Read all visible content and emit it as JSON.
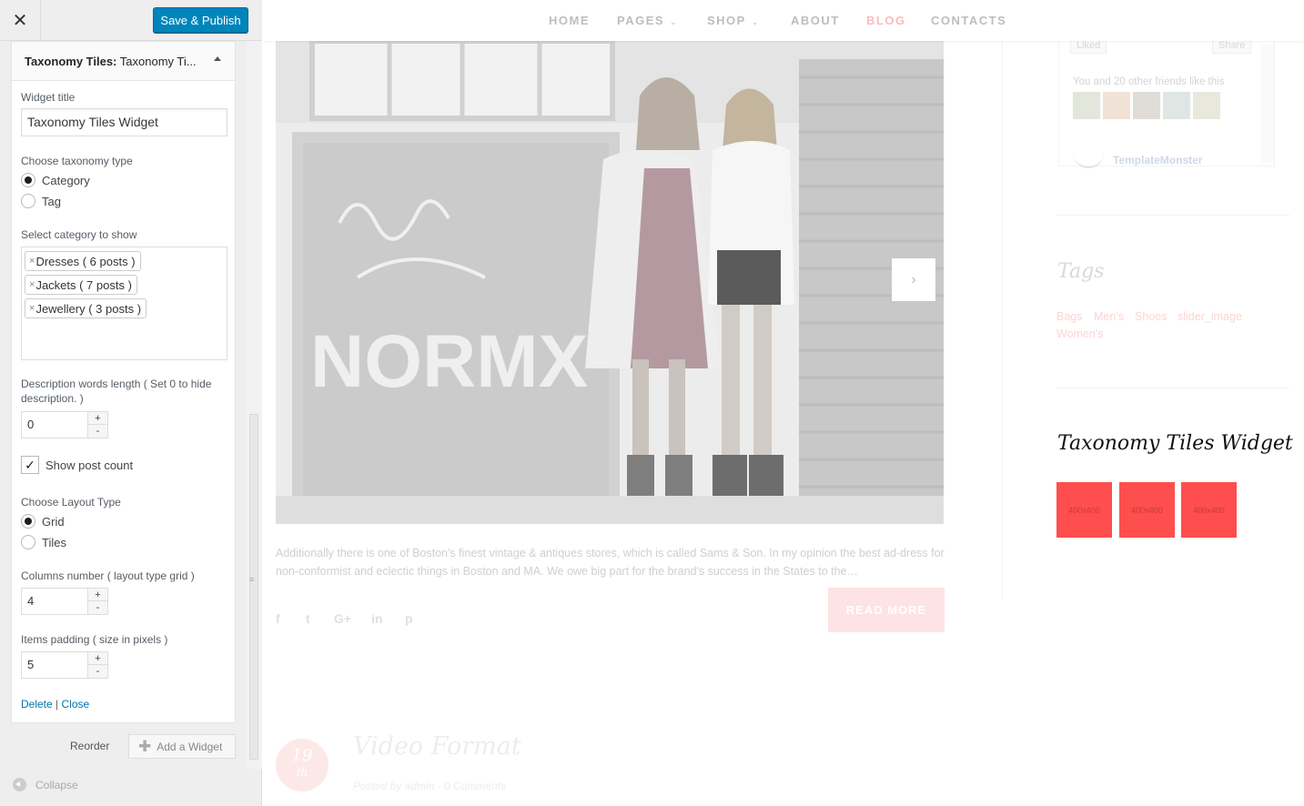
{
  "topbar": {
    "close_glyph": "✕",
    "publish_label": "Save & Publish"
  },
  "widget": {
    "head_bold": "Taxonomy Tiles:",
    "head_sub": "Taxonomy Ti...",
    "title_label": "Widget title",
    "title_value": "Taxonomy Tiles Widget",
    "tax_label": "Choose taxonomy type",
    "tax_options": [
      {
        "label": "Category",
        "checked": true
      },
      {
        "label": "Tag",
        "checked": false
      }
    ],
    "cat_label": "Select category to show",
    "categories": [
      "Dresses ( 6 posts )",
      "Jackets ( 7 posts )",
      "Jewellery ( 3 posts )"
    ],
    "remove_glyph": "×",
    "desc_label_1": "Description words length ( Set 0 to hide",
    "desc_label_2": "description. )",
    "desc_value": "0",
    "show_count_label": "Show post count",
    "show_count_checked": true,
    "layout_label": "Choose Layout Type",
    "layout_options": [
      {
        "label": "Grid",
        "checked": true
      },
      {
        "label": "Tiles",
        "checked": false
      }
    ],
    "columns_label": "Columns number ( layout type grid )",
    "columns_value": "4",
    "padding_label": "Items padding ( size in pixels )",
    "padding_value": "5",
    "spin_up": "+",
    "spin_down": "-",
    "delete_label": "Delete",
    "separator": "|",
    "close_label": "Close"
  },
  "footer": {
    "reorder_label": "Reorder",
    "add_widget_label": "Add a Widget",
    "plus_glyph": "✚",
    "collapse_label": "Collapse"
  },
  "preview": {
    "nav": [
      {
        "label": "HOME",
        "caret": ""
      },
      {
        "label": "PAGES",
        "caret": "⌄"
      },
      {
        "label": "SHOP",
        "caret": "⌄"
      },
      {
        "label": "ABOUT",
        "caret": ""
      },
      {
        "label": "BLOG",
        "caret": "",
        "active": true
      },
      {
        "label": "CONTACTS",
        "caret": ""
      }
    ],
    "slider_next_glyph": "›",
    "excerpt": "Additionally there is one of Boston's finest vintage & antiques stores, which is called Sams & Son. In my opinion the best ad-dress for non-conformist and eclectic things in Boston and MA. We owe big part for the brand's success in the States to the…",
    "share_icons": [
      {
        "name": "facebook-icon",
        "glyph": "f"
      },
      {
        "name": "twitter-icon",
        "glyph": "t"
      },
      {
        "name": "google-plus-icon",
        "glyph": "G+"
      },
      {
        "name": "linkedin-icon",
        "glyph": "in"
      },
      {
        "name": "pinterest-icon",
        "glyph": "p"
      }
    ],
    "read_more": "READ MORE",
    "next_post": {
      "day": "19",
      "month": "th",
      "title": "Video Format",
      "meta": "Posted by admin · 0 Comments"
    },
    "facebook": {
      "liked": "Liked",
      "share": "Share",
      "friends_text": "You and 20 other friends like this",
      "page_name": "TemplateMonster"
    },
    "tags": {
      "title": "Tags",
      "items": [
        "Bags",
        "Men's",
        "Shoes",
        "slider_image",
        "Women's"
      ]
    },
    "tiles_widget": {
      "title": "Taxonomy Tiles Widget",
      "tiles": [
        "400x400",
        "400x400",
        "400x400"
      ]
    }
  },
  "colors": {
    "publish_blue": "#0085ba",
    "link_blue": "#0073aa",
    "tile_red": "#ff4e4e",
    "blog_active": "#f9bcbc"
  }
}
